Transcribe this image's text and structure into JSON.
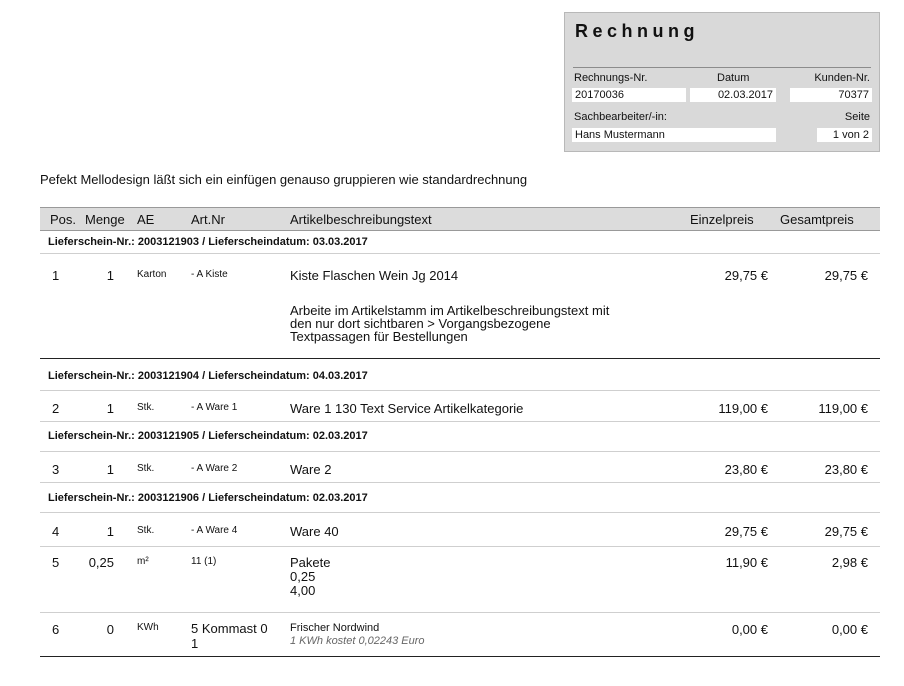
{
  "invoice_box": {
    "title": "Rechnung",
    "number_label": "Rechnungs-Nr.",
    "date_label": "Datum",
    "customer_label": "Kunden-Nr.",
    "number": "20170036",
    "date": "02.03.2017",
    "customer": "70377",
    "clerk_label": "Sachbearbeiter/-in:",
    "page_label": "Seite",
    "clerk": "Hans Mustermann",
    "page": "1 von 2"
  },
  "intro_text": "Pefekt Mellodesign läßt sich ein einfügen genauso gruppieren wie standardrechnung",
  "table": {
    "headers": {
      "pos": "Pos.",
      "qty": "Menge",
      "ae": "AE",
      "art": "Art.Nr",
      "desc": "Artikelbeschreibungstext",
      "unit_price": "Einzelpreis",
      "total": "Gesamtpreis"
    },
    "groups": [
      "Lieferschein-Nr.: 2003121903  /  Lieferscheindatum: 03.03.2017",
      "Lieferschein-Nr.: 2003121904  /  Lieferscheindatum: 04.03.2017",
      "Lieferschein-Nr.: 2003121905  /  Lieferscheindatum: 02.03.2017",
      "Lieferschein-Nr.: 2003121906  /  Lieferscheindatum: 02.03.2017"
    ],
    "rows": [
      {
        "pos": "1",
        "qty": "1",
        "ae": "Karton",
        "art": "- A Kiste",
        "desc": "Kiste Flaschen Wein Jg 2014",
        "desc2": [
          "Arbeite im Artikelstamm im Artikelbeschreibungstext mit",
          "den nur dort sichtbaren > Vorgangsbezogene",
          "Textpassagen für Bestellungen"
        ],
        "unit_price": "29,75 €",
        "total": "29,75 €"
      },
      {
        "pos": "2",
        "qty": "1",
        "ae": "Stk.",
        "art": "- A Ware 1",
        "desc": "Ware 1 130 Text Service Artikelkategorie",
        "unit_price": "119,00 €",
        "total": "119,00 €"
      },
      {
        "pos": "3",
        "qty": "1",
        "ae": "Stk.",
        "art": "- A Ware 2",
        "desc": "Ware 2",
        "unit_price": "23,80 €",
        "total": "23,80 €"
      },
      {
        "pos": "4",
        "qty": "1",
        "ae": "Stk.",
        "art": "- A Ware 4",
        "desc": "Ware 40",
        "unit_price": "29,75 €",
        "total": "29,75 €"
      },
      {
        "pos": "5",
        "qty": "0,25",
        "ae": "m²",
        "art": "11 (1)",
        "desc_lines": [
          "Pakete",
          "0,25",
          "4,00"
        ],
        "unit_price": "11,90 €",
        "total": "2,98 €"
      },
      {
        "pos": "6",
        "qty": "0",
        "ae": "KWh",
        "art_lines": [
          "5 Kommast 0",
          "1"
        ],
        "desc": "Frischer Nordwind",
        "desc_note": "1 KWh kostet 0,02243 Euro",
        "unit_price": "0,00 €",
        "total": "0,00 €"
      }
    ]
  }
}
